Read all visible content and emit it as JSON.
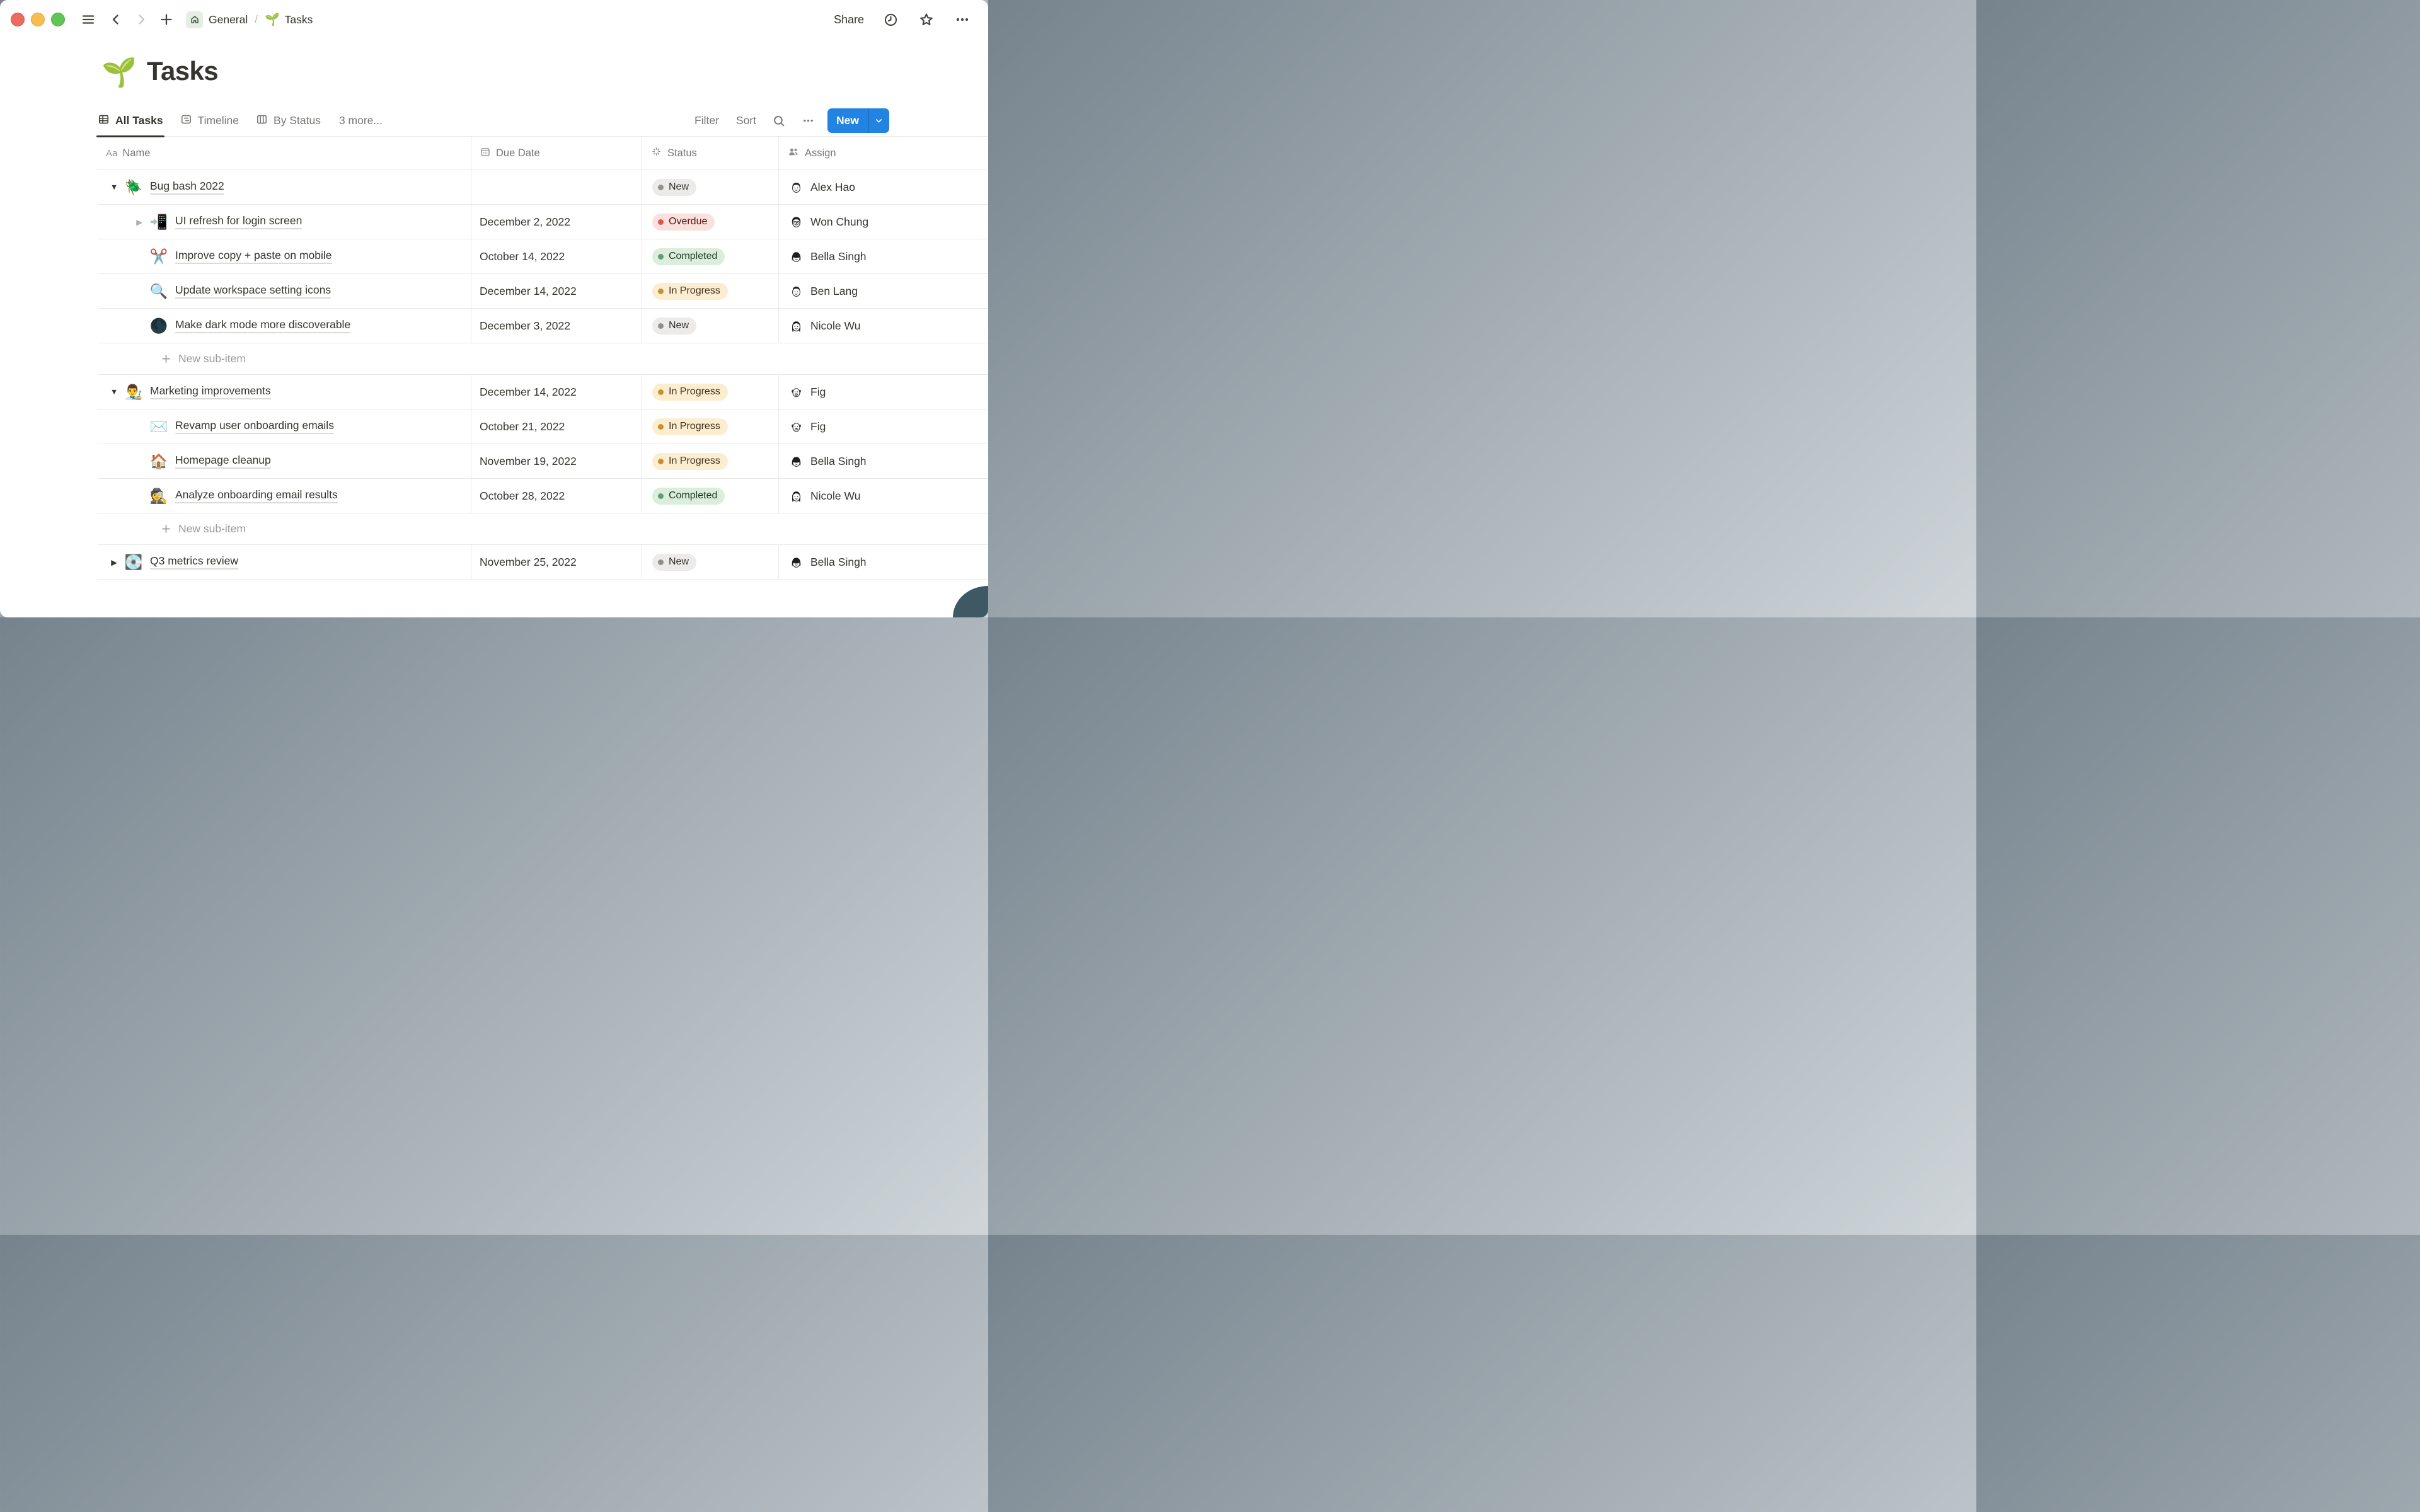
{
  "window": {
    "share_label": "Share",
    "toolbar_icons": [
      "hamburger-icon",
      "chevron-left-icon",
      "chevron-right-icon",
      "plus-icon",
      "home-icon",
      "history-icon",
      "star-icon",
      "ellipsis-icon"
    ]
  },
  "breadcrumb": {
    "root_label": "General",
    "separator": "/",
    "page_emoji": "🌱",
    "page_label": "Tasks"
  },
  "page": {
    "emoji": "🌱",
    "title": "Tasks"
  },
  "views": {
    "tabs": [
      {
        "label": "All Tasks",
        "icon": "table-view-icon",
        "active": true
      },
      {
        "label": "Timeline",
        "icon": "timeline-view-icon",
        "active": false
      },
      {
        "label": "By Status",
        "icon": "board-view-icon",
        "active": false
      }
    ],
    "more_label": "3 more..."
  },
  "controls": {
    "filter_label": "Filter",
    "sort_label": "Sort",
    "search_icon": "search-icon",
    "more_icon": "ellipsis-icon",
    "new_button_label": "New"
  },
  "table": {
    "columns": [
      {
        "label": "Name",
        "icon": "text-icon",
        "icon_text": "Aa"
      },
      {
        "label": "Due Date",
        "icon": "calendar-icon"
      },
      {
        "label": "Status",
        "icon": "status-burst-icon"
      },
      {
        "label": "Assign",
        "icon": "people-icon"
      }
    ],
    "new_sub_item_label": "New sub-item",
    "rows": [
      {
        "type": "task",
        "level": 0,
        "toggle": "expanded",
        "emoji": "🪲",
        "name": "Bug bash 2022",
        "due": "",
        "status": "New",
        "status_variant": "gray",
        "assignee": "Alex Hao",
        "avatar": "man-short-hair"
      },
      {
        "type": "task",
        "level": 1,
        "toggle": "collapsed",
        "toggle_muted": true,
        "emoji": "📲",
        "name": "UI refresh for login screen",
        "due": "December 2, 2022",
        "status": "Overdue",
        "status_variant": "red",
        "assignee": "Won Chung",
        "avatar": "man-glasses"
      },
      {
        "type": "task",
        "level": 1,
        "toggle": null,
        "emoji": "✂️",
        "name": "Improve copy + paste on mobile",
        "due": "October 14, 2022",
        "status": "Completed",
        "status_variant": "green",
        "assignee": "Bella Singh",
        "avatar": "woman-bob"
      },
      {
        "type": "task",
        "level": 1,
        "toggle": null,
        "emoji": "🔍",
        "name": "Update workspace setting icons",
        "due": "December 14, 2022",
        "status": "In Progress",
        "status_variant": "yellow",
        "assignee": "Ben Lang",
        "avatar": "man-short-hair-2"
      },
      {
        "type": "task",
        "level": 1,
        "toggle": null,
        "emoji": "🌑",
        "name": "Make dark mode more discoverable",
        "due": "December 3, 2022",
        "status": "New",
        "status_variant": "gray",
        "assignee": "Nicole Wu",
        "avatar": "woman-long-hair"
      },
      {
        "type": "new_sub_item"
      },
      {
        "type": "task",
        "level": 0,
        "toggle": "expanded",
        "emoji": "👨‍🎨",
        "name": "Marketing improvements",
        "due": "December 14, 2022",
        "status": "In Progress",
        "status_variant": "yellow",
        "assignee": "Fig",
        "avatar": "dog"
      },
      {
        "type": "task",
        "level": 1,
        "toggle": null,
        "emoji": "✉️",
        "name": "Revamp user onboarding emails",
        "due": "October 21, 2022",
        "status": "In Progress",
        "status_variant": "yellow",
        "assignee": "Fig",
        "avatar": "dog"
      },
      {
        "type": "task",
        "level": 1,
        "toggle": null,
        "emoji": "🏠",
        "name": "Homepage cleanup",
        "due": "November 19, 2022",
        "status": "In Progress",
        "status_variant": "yellow",
        "assignee": "Bella Singh",
        "avatar": "woman-bob"
      },
      {
        "type": "task",
        "level": 1,
        "toggle": null,
        "emoji": "🕵️",
        "name": "Analyze onboarding email results",
        "due": "October 28, 2022",
        "status": "Completed",
        "status_variant": "green",
        "assignee": "Nicole Wu",
        "avatar": "woman-long-hair"
      },
      {
        "type": "new_sub_item"
      },
      {
        "type": "task",
        "level": 0,
        "toggle": "collapsed",
        "emoji": "💽",
        "name": "Q3 metrics review",
        "due": "November 25, 2022",
        "status": "New",
        "status_variant": "gray",
        "assignee": "Bella Singh",
        "avatar": "woman-bob"
      }
    ]
  },
  "colors": {
    "accent_blue": "#2383E2",
    "text": "#37352F",
    "muted_text": "#787774",
    "table_line": "#E9E9E7",
    "home_chip_bg": "#E4EEE3",
    "status_gray_bg": "#ECEBE9",
    "status_gray_dot": "#90908C",
    "status_red_bg": "#FAE1DD",
    "status_red_dot": "#DE5550",
    "status_green_bg": "#DBEDDB",
    "status_green_dot": "#649B72",
    "status_yellow_bg": "#FBEDD0",
    "status_yellow_dot": "#C9912E"
  }
}
